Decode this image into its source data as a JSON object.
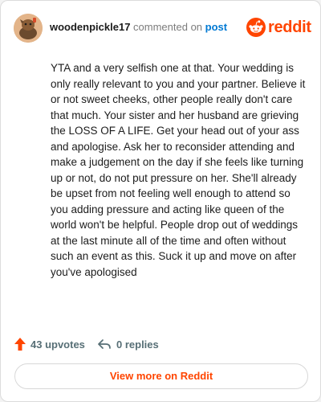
{
  "header": {
    "username": "woodenpickle17",
    "action_text": "commented on",
    "post_link": "post",
    "brand": "reddit"
  },
  "comment": {
    "body": "YTA and a very selfish one at that. Your wedding is only really relevant to you and your partner. Believe it or not sweet cheeks, other people really don't care that much. Your sister and her husband are grieving the LOSS OF A LIFE. Get your head out of your ass and apologise. Ask her to reconsider attending and make a judgement on the day if she feels like turning up or not, do not put pressure on her. She'll already be upset from not feeling well enough to attend so you adding pressure and acting like queen of the world won't be helpful. People drop out of weddings at the last minute all of the time and often without such an event as this. Suck it up and move on after you've apologised"
  },
  "actions": {
    "upvotes": "43 upvotes",
    "replies": "0 replies"
  },
  "footer": {
    "view_more": "View more on Reddit"
  },
  "colors": {
    "brand": "#ff4500",
    "link": "#0079d3",
    "muted": "#576f76"
  },
  "icons": {
    "avatar": "avatar-icon",
    "logo": "reddit-logo-icon",
    "upvote": "upvote-arrow-icon",
    "reply": "reply-arrow-icon"
  }
}
